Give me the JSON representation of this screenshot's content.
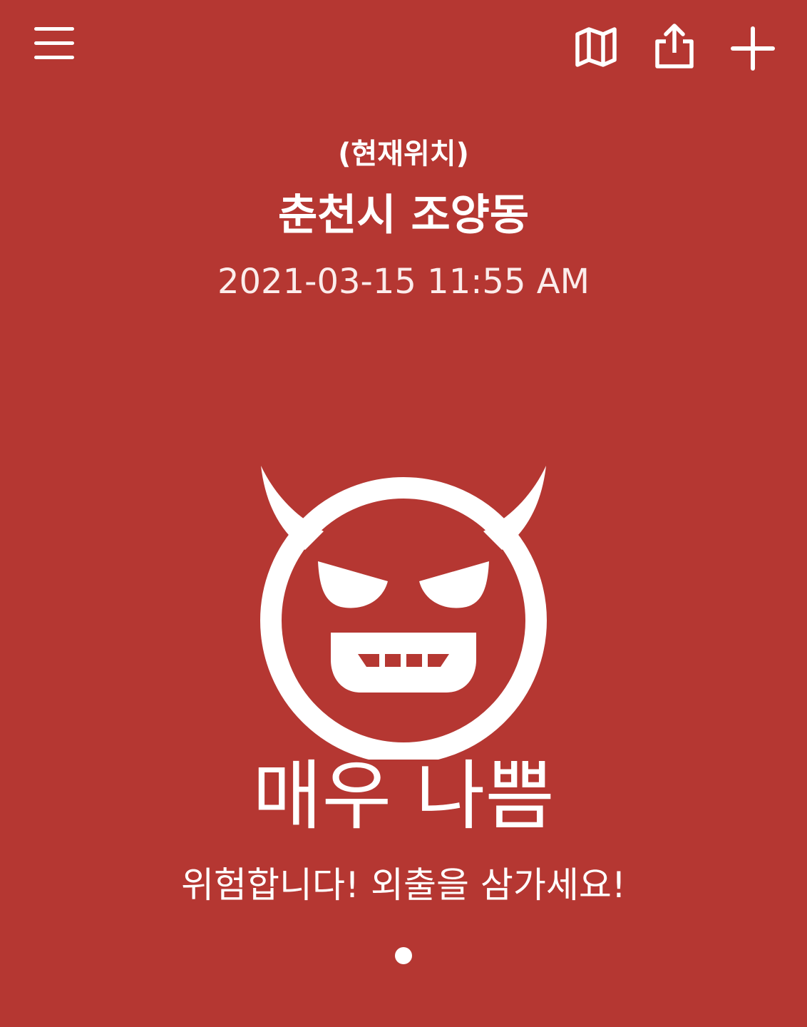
{
  "header": {
    "icons": {
      "menu": "menu-icon",
      "map": "map-icon",
      "share": "share-icon",
      "add": "plus-icon"
    }
  },
  "location": {
    "label": "(현재위치)",
    "name": "춘천시 조양동",
    "timestamp": "2021-03-15 11:55 AM"
  },
  "air_quality": {
    "status": "매우 나쁨",
    "message": "위험합니다! 외출을 삼가세요!",
    "icon": "devil-face-icon"
  },
  "pager": {
    "pages": 1,
    "current": 1
  },
  "colors": {
    "background": "#B53732",
    "foreground": "#FFFFFF"
  }
}
